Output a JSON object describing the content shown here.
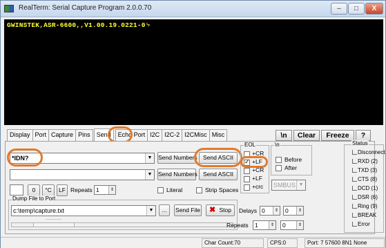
{
  "window": {
    "title": "RealTerm: Serial Capture Program 2.0.0.70",
    "minimize": "–",
    "maximize": "□",
    "close": "X"
  },
  "terminal": {
    "output": "GWINSTEK,ASR-6600,,V1.00.19.0221-0␊"
  },
  "tabs": [
    "Display",
    "Port",
    "Capture",
    "Pins",
    "Send",
    "Echo Port",
    "I2C",
    "I2C-2",
    "I2CMisc",
    "Misc"
  ],
  "active_tab": "Send",
  "right_buttons": {
    "newline": "\\n",
    "clear": "Clear",
    "freeze": "Freeze",
    "help": "?"
  },
  "send": {
    "line1_value": "*IDN?",
    "line2_value": "",
    "send_numbers_1": "Send Numbers",
    "send_ascii_1": "Send ASCII",
    "send_numbers_2": "Send Numbers",
    "send_ascii_2": "Send ASCII",
    "zero_btn": "0",
    "degc_btn": "°C",
    "lf_btn": "LF",
    "repeats_label": "Repeats",
    "repeats_value": "1",
    "literal_label": "Literal",
    "strip_spaces_label": "Strip Spaces"
  },
  "eol": {
    "label": "EOL",
    "cr": "+CR",
    "lf": "+LF",
    "cr2": "+CR",
    "lf2": "+LF",
    "crc": "+crc"
  },
  "nl_group": {
    "label": "\\n",
    "before": "Before",
    "after": "After",
    "smbus": "SMBUS 8"
  },
  "dump": {
    "label": "Dump File to Port",
    "path": "c:\\temp\\capture.txt",
    "browse": "...",
    "send_file": "Send File",
    "stop": "Stop",
    "delays_label": "Delays",
    "delay1": "0",
    "delay2": "0",
    "repeats_label": "Repeats",
    "repeats_value": "1",
    "repeats2_value": "0",
    "progress_text": "............"
  },
  "status": {
    "label": "Status",
    "items": [
      "Disconnect",
      "RXD (2)",
      "TXD (3)",
      "CTS (8)",
      "DCD (1)",
      "DSR (6)",
      "Ring (9)",
      "BREAK",
      "Error"
    ]
  },
  "statusbar": {
    "char_count": "Char Count:70",
    "cps": "CPS:0",
    "port": "Port: 7 57600 8N1 None"
  },
  "colors": {
    "highlight": "#e07a2c",
    "terminal_bg": "#000000",
    "terminal_fg": "#ffff30"
  }
}
